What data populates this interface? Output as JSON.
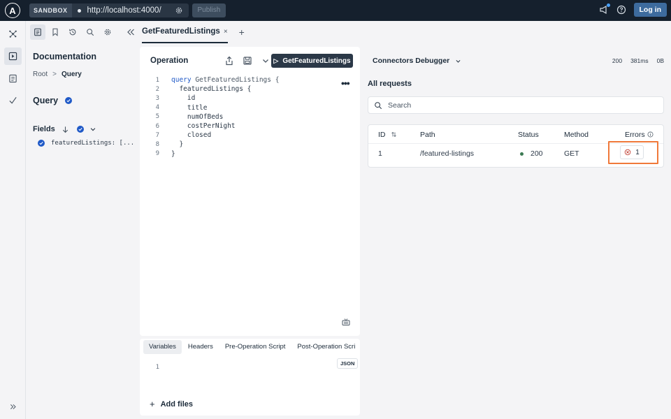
{
  "topbar": {
    "logo": "A",
    "env_badge": "SANDBOX",
    "url": "http://localhost:4000/",
    "publish_label": "Publish",
    "login_label": "Log in",
    "icons": [
      "announcement-icon",
      "help-icon"
    ]
  },
  "rail": {
    "items": [
      "graph-icon",
      "explorer-icon",
      "schema-icon",
      "checks-icon"
    ],
    "active": "explorer-icon",
    "expand_icon": "double-chevron-right-icon"
  },
  "docs_toolbar": {
    "icons": [
      "documentation-icon",
      "bookmark-icon",
      "history-icon",
      "search-icon",
      "gear-icon"
    ]
  },
  "docs": {
    "title": "Documentation",
    "breadcrumb": {
      "root": "Root",
      "sep": ">",
      "current": "Query"
    },
    "query_heading": "Query",
    "fields_label": "Fields",
    "field_item": "featuredListings: [..."
  },
  "tabs": {
    "items": [
      {
        "label": "GetFeaturedListings",
        "close": "×"
      }
    ],
    "add": "+"
  },
  "operation": {
    "title": "Operation",
    "run_label": "GetFeaturedListings",
    "more": "•••",
    "lines": [
      {
        "n": "1",
        "kw": "query",
        "rest": " GetFeaturedListings {"
      },
      {
        "n": "2",
        "kw": "",
        "rest": "  featuredListings {"
      },
      {
        "n": "3",
        "kw": "",
        "rest": "    id"
      },
      {
        "n": "4",
        "kw": "",
        "rest": "    title"
      },
      {
        "n": "5",
        "kw": "",
        "rest": "    numOfBeds"
      },
      {
        "n": "6",
        "kw": "",
        "rest": "    costPerNight"
      },
      {
        "n": "7",
        "kw": "",
        "rest": "    closed"
      },
      {
        "n": "8",
        "kw": "",
        "rest": "  }"
      },
      {
        "n": "9",
        "kw": "",
        "rest": "}"
      }
    ]
  },
  "variables": {
    "tabs": [
      "Variables",
      "Headers",
      "Pre-Operation Script",
      "Post-Operation Scri"
    ],
    "active_tab": "Variables",
    "json_badge": "JSON",
    "line_number": "1",
    "add_files": "Add files"
  },
  "debugger": {
    "title": "Connectors Debugger",
    "stats": {
      "status": "200",
      "time": "381ms",
      "size": "0B"
    },
    "section_title": "All requests",
    "search_placeholder": "Search",
    "columns": {
      "id": "ID",
      "path": "Path",
      "status": "Status",
      "method": "Method",
      "errors": "Errors"
    },
    "rows": [
      {
        "id": "1",
        "path": "/featured-listings",
        "status": "200",
        "method": "GET",
        "errors": "1"
      }
    ]
  }
}
